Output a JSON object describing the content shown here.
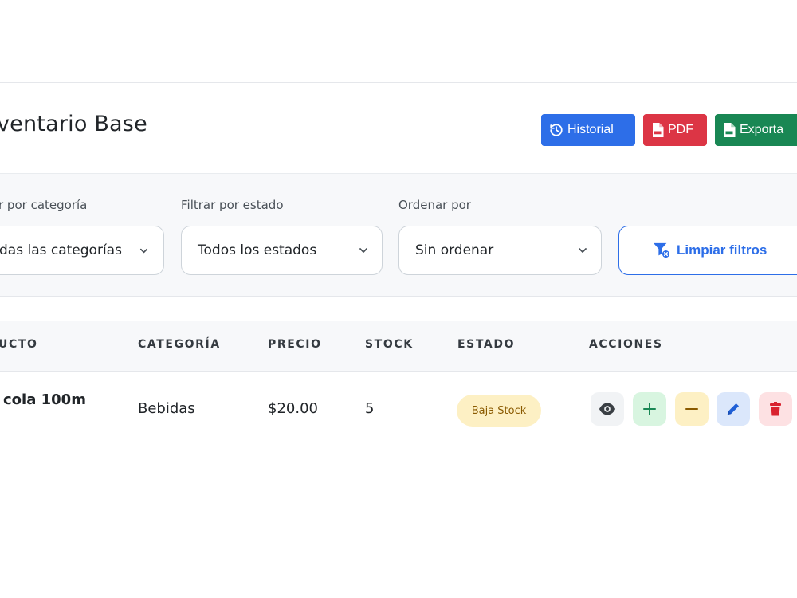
{
  "header": {
    "title": "ventario Base",
    "buttons": {
      "historial": "Historial",
      "pdf": "PDF",
      "export": "Exporta"
    }
  },
  "filters": {
    "category": {
      "label": "r por categoría",
      "value": "das las categorías"
    },
    "status": {
      "label": "Filtrar por estado",
      "value": "Todos los estados"
    },
    "sort": {
      "label": "Ordenar por",
      "value": "Sin ordenar"
    },
    "clear_label": "Limpiar filtros"
  },
  "table": {
    "columns": [
      "UCTO",
      "CATEGORÍA",
      "PRECIO",
      "STOCK",
      "ESTADO",
      "ACCIONES"
    ],
    "rows": [
      {
        "product": "cola 100m",
        "category": "Bebidas",
        "price": "$20.00",
        "stock": "5",
        "status": "Baja Stock"
      }
    ]
  },
  "icons": {
    "historial": "history-icon",
    "pdf": "file-pdf-icon",
    "export": "file-excel-icon",
    "clear": "filter-clear-icon",
    "chevron": "chevron-down-icon",
    "view": "eye-icon",
    "add": "plus-icon",
    "subtract": "minus-icon",
    "edit": "pencil-icon",
    "delete": "trash-icon"
  },
  "colors": {
    "primary": "#2d6ee8",
    "danger": "#dc3545",
    "success": "#198754",
    "warning_bg": "#fdf0c4",
    "warning_text": "#8a5a00"
  }
}
